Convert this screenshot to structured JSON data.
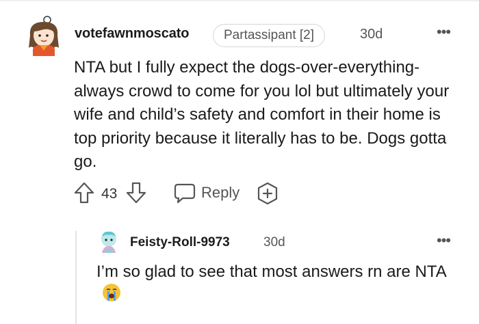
{
  "comment": {
    "author": "votefawnmoscato",
    "flair": "Partassipant [2]",
    "time": "30d",
    "more_label": "•••",
    "body": "NTA but I fully expect the dogs-over-everything-always crowd to come for you lol but ultimately your wife and child’s safety and comfort in their home is top priority because it literally has to be. Dogs gotta go.",
    "votes": "43",
    "reply_label": "Reply",
    "icons": [
      "upvote-icon",
      "downvote-icon",
      "reply-bubble-icon",
      "add-award-icon",
      "more-options-icon"
    ]
  },
  "reply": {
    "author": "Feisty-Roll-9973",
    "time": "30d",
    "more_label": "•••",
    "body": "I’m so glad to see that most answers rn are NTA",
    "emoji": "crying-face-emoji"
  },
  "colors": {
    "text": "#1a1a1b",
    "meta": "#555555",
    "flair_border": "#d6d6d6",
    "thread_line": "#e3e3e3",
    "emoji_yellow": "#f5c23c",
    "tears_blue": "#4aa7e8"
  }
}
